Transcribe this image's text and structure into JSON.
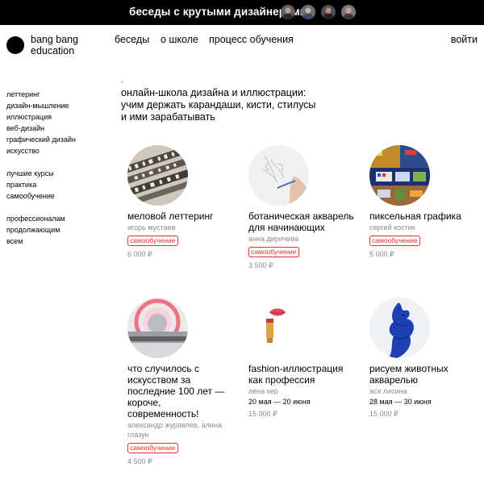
{
  "topbar": {
    "title": "беседы с крутыми дизайнерами",
    "speakers": [
      "speaker-1",
      "speaker-2",
      "speaker-3",
      "speaker-4"
    ]
  },
  "header": {
    "logo_line1": "bang bang",
    "logo_line2": "education",
    "nav": [
      "беседы",
      "о школе",
      "процесс обучения"
    ],
    "login": "войти"
  },
  "sidebar": {
    "categories": [
      "леттеринг",
      "дизайн-мышление",
      "иллюстрация",
      "веб-дизайн",
      "графический дизайн",
      "искусство"
    ],
    "formats": [
      "лучшие курсы",
      "практика",
      "самообучение"
    ],
    "levels": [
      "профессионалам",
      "продолжающим",
      "всем"
    ]
  },
  "main": {
    "headline": [
      "онлайн-школа дизайна и иллюстрации:",
      "учим держать карандаши, кисти, стилусы",
      "и ими зарабатывать"
    ],
    "courses": [
      {
        "title": [
          "меловой леттеринг"
        ],
        "author": [
          "игорь мустаев"
        ],
        "badge": "самообучение",
        "price": "6 000 ₽"
      },
      {
        "title": [
          "ботаническая акварель",
          "для начинающих"
        ],
        "author": [
          "анна диричева"
        ],
        "badge": "самообучение",
        "price": "3 500 ₽"
      },
      {
        "title": [
          "пиксельная графика"
        ],
        "author": [
          "сергей костик"
        ],
        "badge": "самообучение",
        "price": "5 000 ₽"
      },
      {
        "title": [
          "что случилось с",
          "искусством за",
          "последние 100 лет —",
          "короче,",
          "современность!"
        ],
        "author": [
          "александр журавлев, алина",
          "глазун"
        ],
        "badge": "самообучение",
        "price": "4 500 ₽"
      },
      {
        "title": [
          "fashion-иллюстрация",
          "как профессия"
        ],
        "author": [
          "лена кер"
        ],
        "dates": "20 мая — 20 июня",
        "price": "15 000 ₽"
      },
      {
        "title": [
          "рисуем животных",
          "акварелью"
        ],
        "author": [
          "ася лисина"
        ],
        "dates": "28 мая — 30 июня",
        "price": "15 000 ₽"
      }
    ]
  },
  "colors": {
    "badge": "#e4322b",
    "muted_text": "#8a8a8a",
    "topbar_bg": "#000000"
  }
}
